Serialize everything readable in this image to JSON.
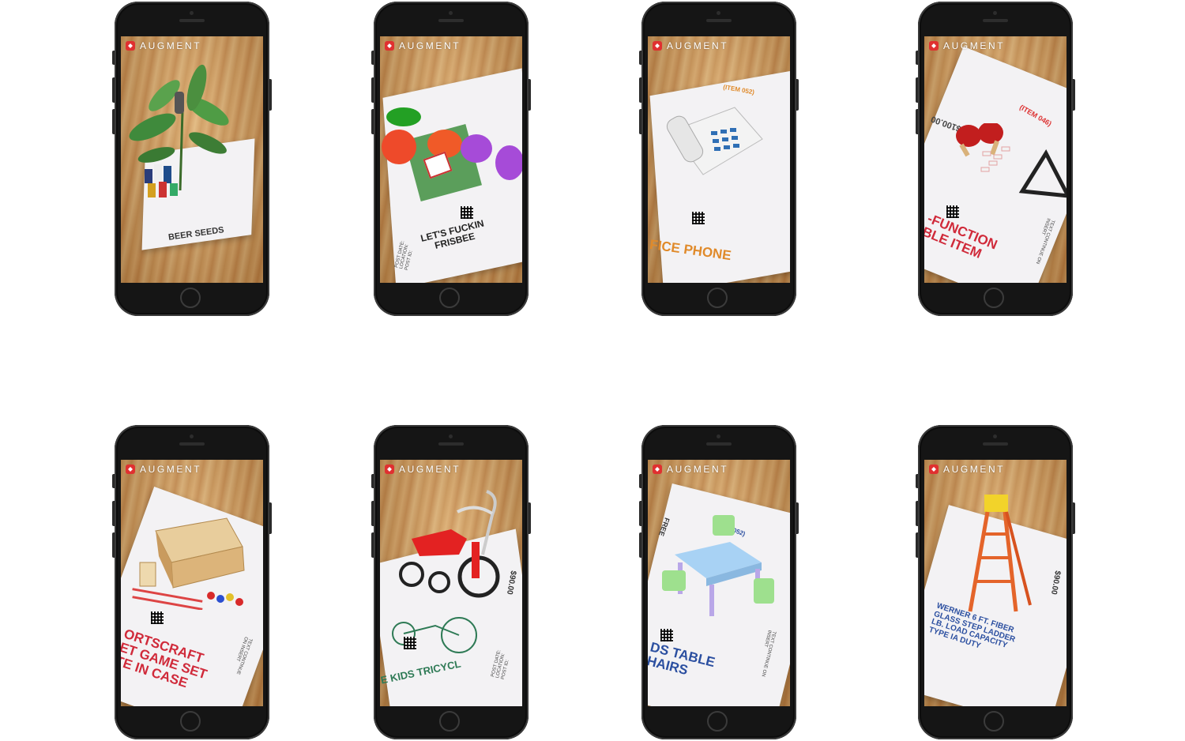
{
  "app": {
    "brand": "AUGMENT"
  },
  "screens": [
    {
      "name": "plant",
      "headline": "BEER SEEDS"
    },
    {
      "name": "frisbee",
      "headline": "LET'S FUCKIN\nFRISBEE",
      "sub": "POST DATE:\nLOCATION:\nPOST ID:"
    },
    {
      "name": "phone",
      "headline": "FICE PHONE",
      "item": "(ITEM 052)"
    },
    {
      "name": "pingpong",
      "headline": "-FUNCTION\nBLE ITEM",
      "item": "(ITEM 046)",
      "price": "$100.00",
      "side": "TEXT CONTINUE ON INSERT"
    },
    {
      "name": "bocce",
      "headline": "ORTSCRAFT\nET GAME SET\nTE IN CASE",
      "side": "TEXT CONTINUE ON INSERT"
    },
    {
      "name": "tricycle",
      "headline": "E KIDS TRICYCL",
      "price": "$90.00",
      "sub": "POST DATE:\nLOCATION:\nPOST ID:"
    },
    {
      "name": "kids-table",
      "headline": "DS TABLE\nHAIRS",
      "item": "(ITEM 052)",
      "side": "TEXT CONTINUE ON INSERT",
      "tag": "FREE"
    },
    {
      "name": "ladder",
      "headline": "WERNER 6 FT. FIBER\nGLASS STEP LADDER\nLB. LOAD CAPACITY\nTYPE IA DUTY",
      "price": "$90.00"
    }
  ]
}
